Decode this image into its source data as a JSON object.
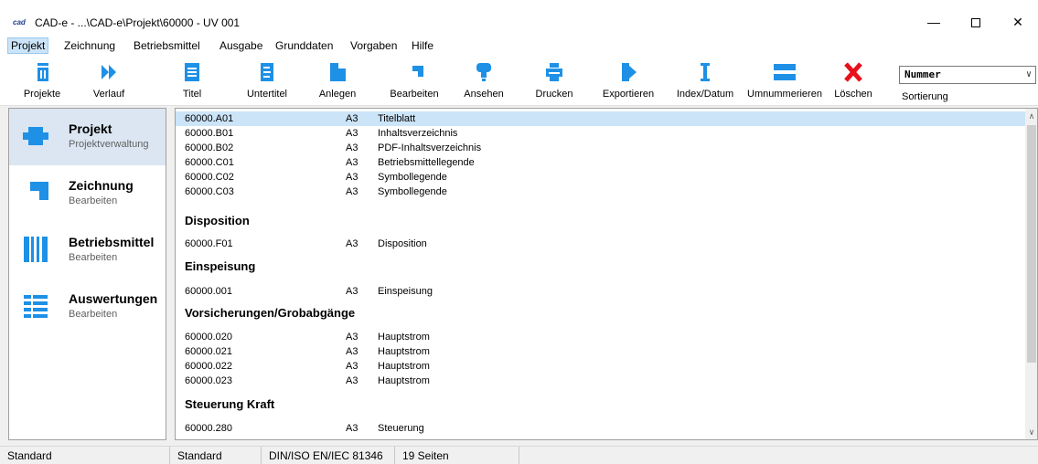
{
  "window": {
    "logo_text": "cad",
    "title": "CAD-e - ...\\CAD-e\\Projekt\\60000 - UV 001",
    "minimize": "—",
    "close": "✕"
  },
  "menu": [
    {
      "label": "Projekt"
    },
    {
      "label": "Zeichnung"
    },
    {
      "label": "Betriebsmittel"
    },
    {
      "label": "Ausgabe"
    },
    {
      "label": "Grunddaten"
    },
    {
      "label": "Vorgaben"
    },
    {
      "label": "Hilfe"
    }
  ],
  "toolbar": {
    "buttons": [
      {
        "label": "Projekte",
        "icon": "projects-icon"
      },
      {
        "label": "Verlauf",
        "icon": "history-icon"
      },
      {
        "label": "Titel",
        "icon": "title-icon"
      },
      {
        "label": "Untertitel",
        "icon": "subtitle-icon"
      },
      {
        "label": "Anlegen",
        "icon": "create-icon"
      },
      {
        "label": "Bearbeiten",
        "icon": "edit-icon"
      },
      {
        "label": "Ansehen",
        "icon": "view-icon"
      },
      {
        "label": "Drucken",
        "icon": "print-icon"
      },
      {
        "label": "Exportieren",
        "icon": "export-icon"
      },
      {
        "label": "Index/Datum",
        "icon": "index-date-icon"
      },
      {
        "label": "Umnummerieren",
        "icon": "renumber-icon"
      },
      {
        "label": "Löschen",
        "icon": "delete-icon"
      }
    ],
    "sort_value": "Nummer",
    "sort_label": "Sortierung"
  },
  "sidebar": {
    "items": [
      {
        "title": "Projekt",
        "subtitle": "Projektverwaltung",
        "icon": "project-icon"
      },
      {
        "title": "Zeichnung",
        "subtitle": "Bearbeiten",
        "icon": "drawing-icon"
      },
      {
        "title": "Betriebsmittel",
        "subtitle": "Bearbeiten",
        "icon": "equipment-icon"
      },
      {
        "title": "Auswertungen",
        "subtitle": "Bearbeiten",
        "icon": "reports-icon"
      }
    ]
  },
  "list": {
    "rows": [
      {
        "id": "60000.A01",
        "format": "A3",
        "desc": "Titelblatt"
      },
      {
        "id": "60000.B01",
        "format": "A3",
        "desc": "Inhaltsverzeichnis"
      },
      {
        "id": "60000.B02",
        "format": "A3",
        "desc": "PDF-Inhaltsverzeichnis"
      },
      {
        "id": "60000.C01",
        "format": "A3",
        "desc": "Betriebsmittellegende"
      },
      {
        "id": "60000.C02",
        "format": "A3",
        "desc": "Symbollegende"
      },
      {
        "id": "60000.C03",
        "format": "A3",
        "desc": "Symbollegende"
      },
      {
        "id": "60000.F01",
        "format": "A3",
        "desc": "Disposition"
      },
      {
        "id": "60000.001",
        "format": "A3",
        "desc": "Einspeisung"
      },
      {
        "id": "60000.020",
        "format": "A3",
        "desc": "Hauptstrom"
      },
      {
        "id": "60000.021",
        "format": "A3",
        "desc": "Hauptstrom"
      },
      {
        "id": "60000.022",
        "format": "A3",
        "desc": "Hauptstrom"
      },
      {
        "id": "60000.023",
        "format": "A3",
        "desc": "Hauptstrom"
      },
      {
        "id": "60000.280",
        "format": "A3",
        "desc": "Steuerung"
      }
    ],
    "groups": [
      "Disposition",
      "Einspeisung",
      "Vorsicherungen/Grobabgänge",
      "Steuerung Kraft"
    ]
  },
  "status": {
    "left": "Standard",
    "template": "Standard",
    "standard": "DIN/ISO EN/IEC 81346",
    "pages": "19 Seiten"
  },
  "colors": {
    "accent": "#1e90e6",
    "delete": "#e8101a",
    "selection": "#cce4f7"
  }
}
